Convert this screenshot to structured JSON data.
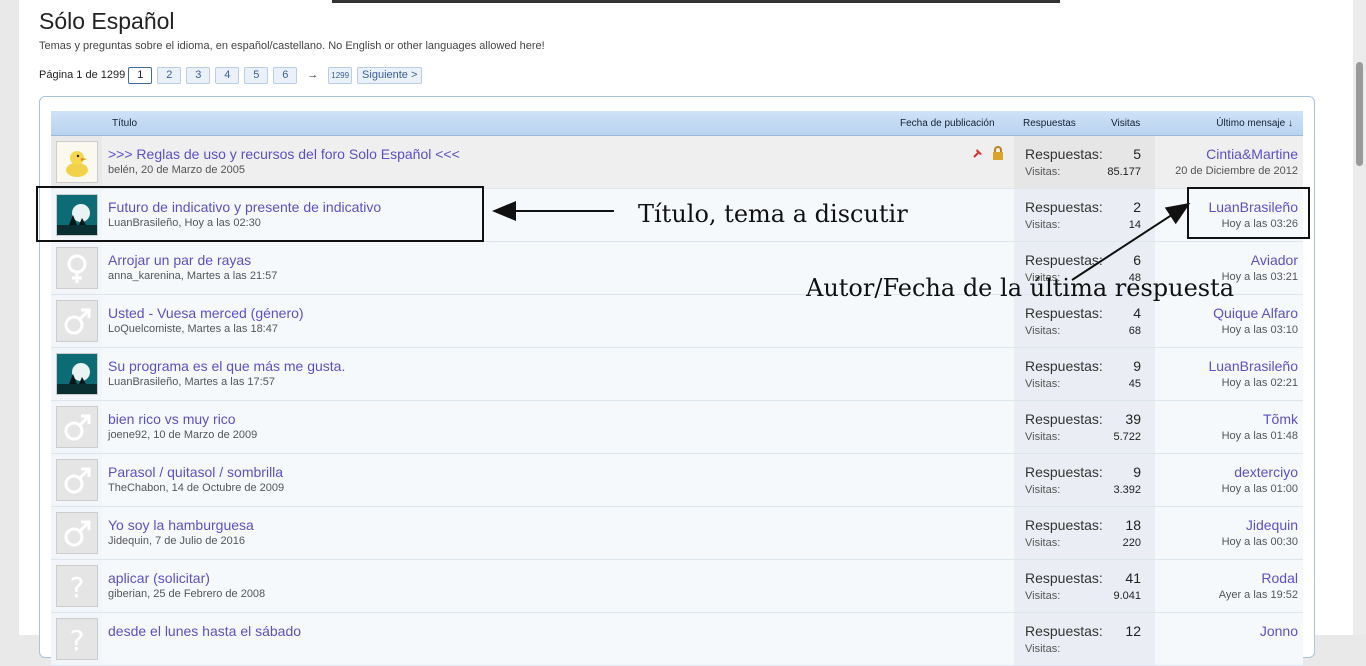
{
  "forum": {
    "title": "Sólo Español",
    "description": "Temas y preguntas sobre el idioma, en español/castellano. No English or other languages allowed here!"
  },
  "pagination": {
    "label": "Página 1 de 1299",
    "pages": [
      "1",
      "2",
      "3",
      "4",
      "5",
      "6"
    ],
    "arrow": "→",
    "last": "1299",
    "next": "Siguiente >"
  },
  "columns": {
    "title": "Título",
    "date": "Fecha de publicación",
    "replies": "Respuestas",
    "views": "Visitas",
    "last": "Último mensaje ↓"
  },
  "labels": {
    "replies": "Respuestas:",
    "views": "Visitas:"
  },
  "threads": [
    {
      "title": ">>> Reglas de uso y recursos del foro Solo Español <<<",
      "meta": "belén, 20 de Marzo de 2005",
      "replies": "5",
      "views": "85.177",
      "last_user": "Cintia&Martine",
      "last_time": "20 de Diciembre de 2012",
      "avatar": "duck-icon",
      "sticky": true
    },
    {
      "title": "Futuro de indicativo y presente de indicativo",
      "meta": "LuanBrasileño, Hoy a las 02:30",
      "replies": "2",
      "views": "14",
      "last_user": "LuanBrasileño",
      "last_time": "Hoy a las 03:26",
      "avatar": "moon-rider-icon"
    },
    {
      "title": "Arrojar un par de rayas",
      "meta": "anna_karenina, Martes a las 21:57",
      "replies": "6",
      "views": "48",
      "last_user": "Aviador",
      "last_time": "Hoy a las 03:21",
      "avatar": "female-icon"
    },
    {
      "title": "Usted - Vuesa merced (género)",
      "meta": "LoQuelcomiste, Martes a las 18:47",
      "replies": "4",
      "views": "68",
      "last_user": "Quique Alfaro",
      "last_time": "Hoy a las 03:10",
      "avatar": "male-icon"
    },
    {
      "title": "Su programa es el que más me gusta.",
      "meta": "LuanBrasileño, Martes a las 17:57",
      "replies": "9",
      "views": "45",
      "last_user": "LuanBrasileño",
      "last_time": "Hoy a las 02:21",
      "avatar": "moon-rider-icon"
    },
    {
      "title": "bien rico vs muy rico",
      "meta": "joene92, 10 de Marzo de 2009",
      "replies": "39",
      "views": "5.722",
      "last_user": "Tõmk",
      "last_time": "Hoy a las 01:48",
      "avatar": "male-icon"
    },
    {
      "title": "Parasol / quitasol / sombrilla",
      "meta": "TheChabon, 14 de Octubre de 2009",
      "replies": "9",
      "views": "3.392",
      "last_user": "dexterciyo",
      "last_time": "Hoy a las 01:00",
      "avatar": "male-icon"
    },
    {
      "title": "Yo soy la hamburguesa",
      "meta": "Jidequin, 7 de Julio de 2016",
      "replies": "18",
      "views": "220",
      "last_user": "Jidequin",
      "last_time": "Hoy a las 00:30",
      "avatar": "male-icon"
    },
    {
      "title": "aplicar (solicitar)",
      "meta": "giberian, 25 de Febrero de 2008",
      "replies": "41",
      "views": "9.041",
      "last_user": "Rodal",
      "last_time": "Ayer a las 19:52",
      "avatar": "question-icon"
    },
    {
      "title": "desde el lunes hasta el sábado",
      "meta": "",
      "replies": "12",
      "views": "",
      "last_user": "Jonno",
      "last_time": "",
      "avatar": "question-icon"
    }
  ],
  "annotations": {
    "title_note": "Título, tema a discutir",
    "last_note": "Autor/Fecha de la última respuesta"
  }
}
